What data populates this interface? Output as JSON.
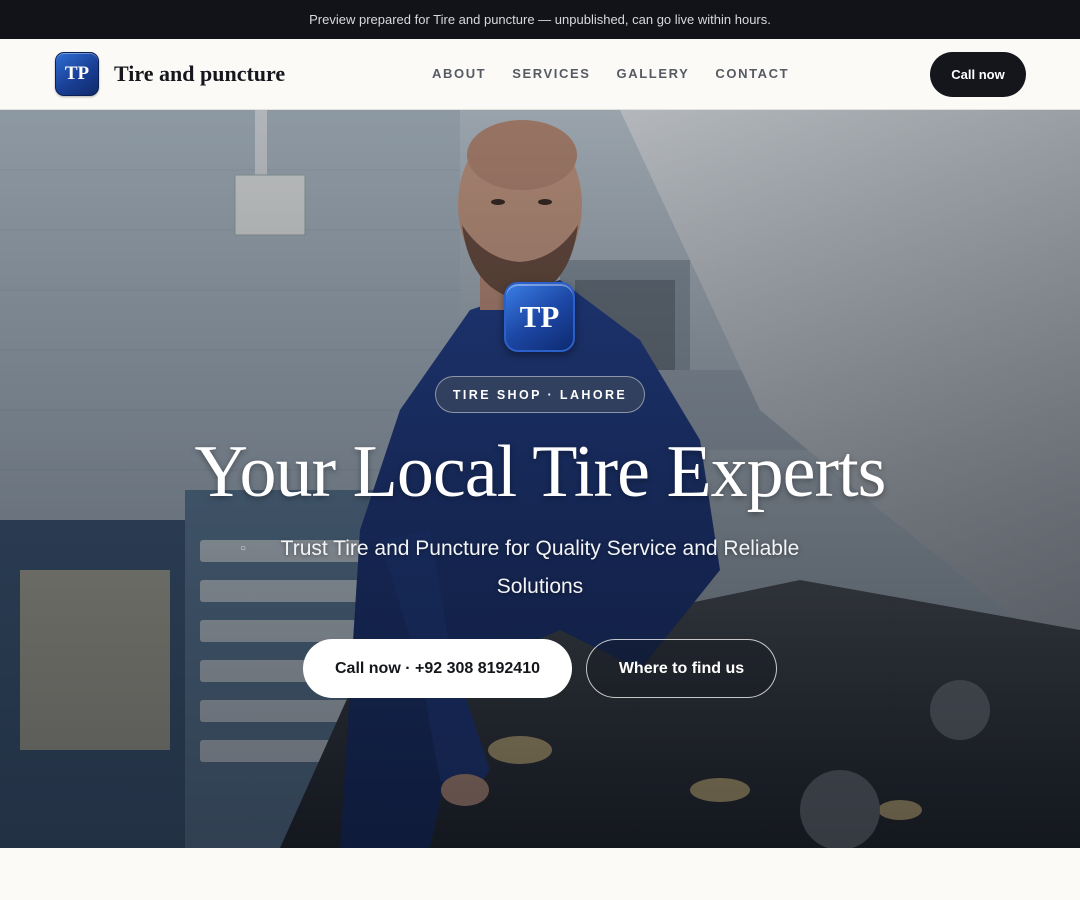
{
  "preview_banner": {
    "text": "Preview prepared for Tire and puncture — unpublished, can go live within hours."
  },
  "header": {
    "logo_text": "TP",
    "brand_name": "Tire and puncture",
    "nav": [
      {
        "label": "ABOUT"
      },
      {
        "label": "SERVICES"
      },
      {
        "label": "GALLERY"
      },
      {
        "label": "CONTACT"
      }
    ],
    "cta_label": "Call now"
  },
  "hero": {
    "logo_text": "TP",
    "eyebrow": "TIRE SHOP · LAHORE",
    "title": "Your Local Tire Experts",
    "subtitle": "Trust Tire and Puncture for Quality Service and Reliable Solutions",
    "primary_button": "Call now · +92 308 8192410",
    "secondary_button": "Where to find us",
    "background_image": "mechanic-working-under-car-hood-photo"
  },
  "colors": {
    "banner_bg": "#111318",
    "page_bg": "#fbfaf7",
    "dark_button": "#14161b",
    "logo_blue": "#1a3f95"
  }
}
